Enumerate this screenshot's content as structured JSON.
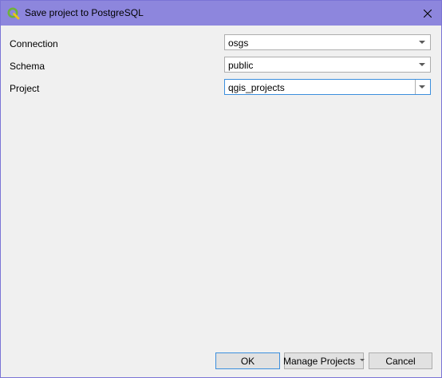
{
  "window": {
    "title": "Save project to PostgreSQL",
    "app_icon": "qgis-logo-icon",
    "close_icon": "close-icon"
  },
  "form": {
    "connection": {
      "label": "Connection",
      "value": "osgs"
    },
    "schema": {
      "label": "Schema",
      "value": "public"
    },
    "project": {
      "label": "Project",
      "value": "qgis_projects"
    }
  },
  "buttons": {
    "ok": "OK",
    "manage_projects": "Manage Projects",
    "cancel": "Cancel"
  },
  "colors": {
    "titlebar": "#8d86dd",
    "focus_border": "#3c8fdd",
    "qgis_green": "#6fb23a",
    "qgis_yellow": "#f0c419"
  }
}
